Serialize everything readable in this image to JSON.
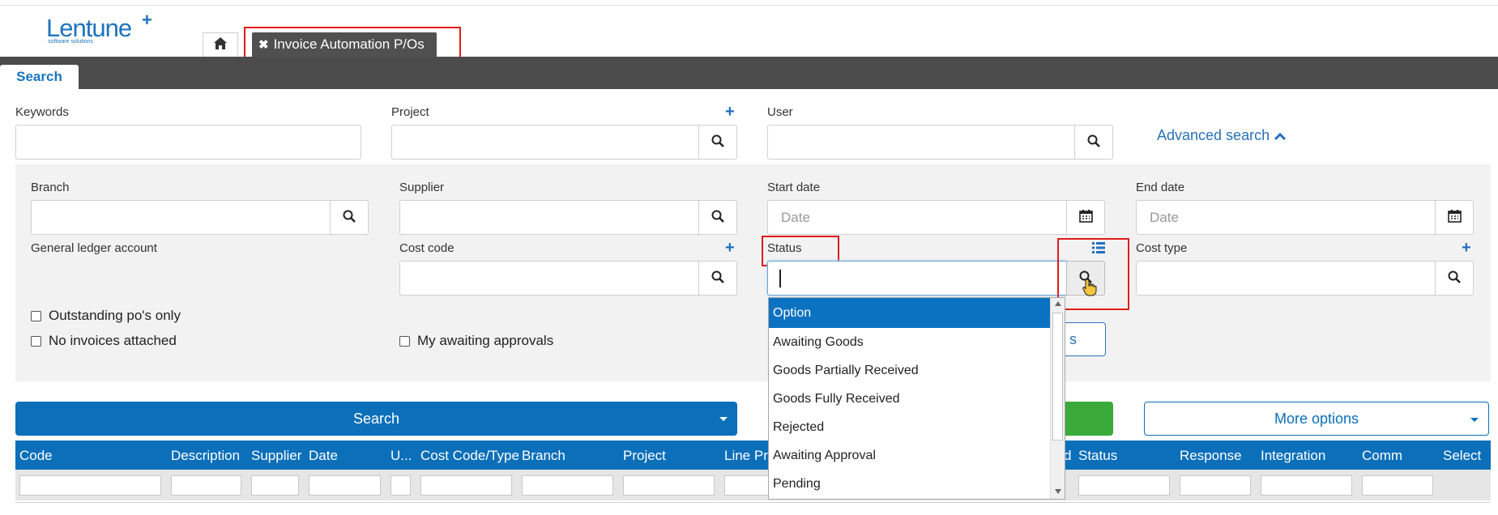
{
  "brand": {
    "name": "Lentune",
    "plus": "+",
    "tagline": "software solutions"
  },
  "tabs": {
    "home_icon": "home-icon",
    "active_label": "Invoice Automation P/Os",
    "close_glyph": "✖"
  },
  "page_tab": "Search",
  "fields": {
    "keywords": "Keywords",
    "project": "Project",
    "user": "User",
    "advanced_search": "Advanced search",
    "branch": "Branch",
    "supplier": "Supplier",
    "start_date": "Start date",
    "end_date": "End date",
    "date_placeholder": "Date",
    "gl_account": "General ledger account",
    "cost_code": "Cost code",
    "status": "Status",
    "cost_type": "Cost type"
  },
  "checkboxes": {
    "outstanding": "Outstanding po's only",
    "no_invoices": "No invoices attached",
    "my_approvals": "My awaiting approvals"
  },
  "status_dropdown": {
    "options": [
      "Option",
      "Awaiting Goods",
      "Goods Partially Received",
      "Goods Fully Received",
      "Rejected",
      "Awaiting Approval",
      "Pending"
    ],
    "selected": "Option"
  },
  "partial_button_text": "s",
  "buttons": {
    "search": "Search",
    "more_options": "More options"
  },
  "table": {
    "columns": [
      "Code",
      "Description",
      "Supplier",
      "Date",
      "U...",
      "Cost Code/Type",
      "Branch",
      "Project",
      "Line Pr",
      "d",
      "Status",
      "Response",
      "Integration",
      "Comm",
      "Select"
    ]
  },
  "colors": {
    "primary": "#0b6fba",
    "dark_bar": "#4b4b4b",
    "highlight_box": "#e01b1b",
    "green": "#3aaa3a",
    "panel_bg": "#f2f2f2"
  }
}
